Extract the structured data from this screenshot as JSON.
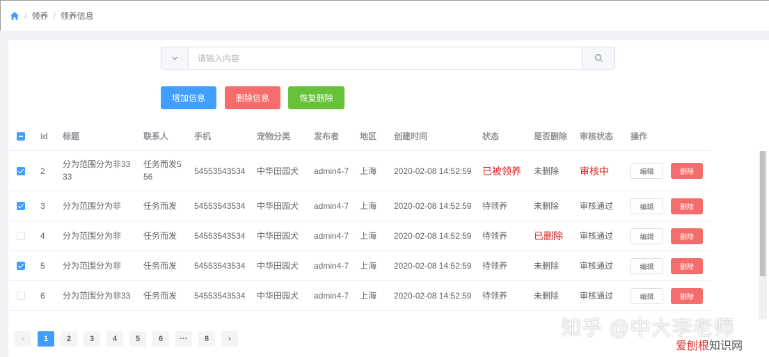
{
  "breadcrumb": {
    "items": [
      "领养",
      "领养信息"
    ],
    "separator": "/"
  },
  "search": {
    "placeholder": "请输入内容",
    "value": ""
  },
  "toolbar": {
    "add_label": "增加信息",
    "delete_label": "删除信息",
    "restore_label": "恢复删除"
  },
  "table": {
    "columns": [
      "Id",
      "标题",
      "联系人",
      "手机",
      "宠物分类",
      "发布者",
      "地区",
      "创建时间",
      "状态",
      "是否删除",
      "审核状态",
      "操作"
    ],
    "edit_label": "编辑",
    "delete_label": "删除",
    "rows": [
      {
        "checked": true,
        "id": "2",
        "title1": "分为范围分为非33",
        "title2": "33",
        "contact1": "任务而发5",
        "contact2": "56",
        "phone": "54553543534",
        "category": "中华田园犬",
        "publisher": "admin4-7",
        "region": "上海",
        "created": "2020-02-08 14:52:59",
        "status": "已被领养",
        "deleted": "未删除",
        "review": "审核中"
      },
      {
        "checked": true,
        "id": "3",
        "title1": "分为范围分为非",
        "title2": "",
        "contact1": "任务而发",
        "contact2": "",
        "phone": "54553543534",
        "category": "中华田园犬",
        "publisher": "admin4-7",
        "region": "上海",
        "created": "2020-02-08 14:52:59",
        "status": "待领养",
        "deleted": "未删除",
        "review": "审核通过"
      },
      {
        "checked": false,
        "id": "4",
        "title1": "分为范围分为非",
        "title2": "",
        "contact1": "任务而发",
        "contact2": "",
        "phone": "54553543534",
        "category": "中华田园犬",
        "publisher": "admin4-7",
        "region": "上海",
        "created": "2020-02-08 14:52:59",
        "status": "待领养",
        "deleted": "已删除",
        "review": "审核通过"
      },
      {
        "checked": true,
        "id": "5",
        "title1": "分为范围分为非",
        "title2": "",
        "contact1": "任务而发",
        "contact2": "",
        "phone": "54553543534",
        "category": "中华田园犬",
        "publisher": "admin4-7",
        "region": "上海",
        "created": "2020-02-08 14:52:59",
        "status": "待领养",
        "deleted": "未删除",
        "review": "审核通过"
      },
      {
        "checked": false,
        "id": "6",
        "title1": "分为范围分为非33",
        "title2": "",
        "contact1": "任务而发",
        "contact2": "",
        "phone": "54553543534",
        "category": "中华田园犬",
        "publisher": "admin4-7",
        "region": "上海",
        "created": "2020-02-08 14:52:59",
        "status": "待领养",
        "deleted": "未删除",
        "review": "审核通过"
      }
    ]
  },
  "pagination": {
    "prev": "‹",
    "pages": [
      "1",
      "2",
      "3",
      "4",
      "5",
      "6",
      "···",
      "8"
    ],
    "next": "›",
    "current": "1"
  },
  "watermark": {
    "line1": "知乎 @中大李老师",
    "line2_a": "爱刨根",
    "line2_b": "知识网"
  },
  "colors": {
    "primary": "#409eff",
    "danger": "#f56c6c",
    "success": "#67c23a",
    "red_text": "#e02020"
  }
}
